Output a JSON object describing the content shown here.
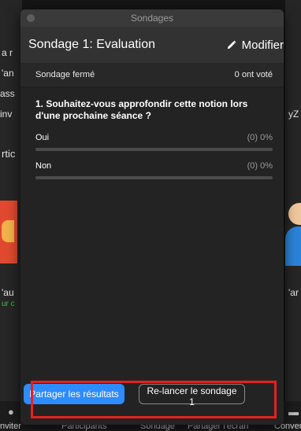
{
  "window": {
    "title": "Sondages"
  },
  "poll": {
    "title": "Sondage 1: Evaluation",
    "modify_label": "Modifier",
    "status": "Sondage fermé",
    "vote_count": "0 ont voté",
    "question": "1. Souhaitez-vous approfondir cette notion lors d'une prochaine séance ?",
    "answers": [
      {
        "label": "Oui",
        "result": "(0) 0%",
        "fraction": 0
      },
      {
        "label": "Non",
        "result": "(0) 0%",
        "fraction": 0
      }
    ],
    "share_button": "Partager les résultats",
    "relaunch_button": "Re-lancer le sondage 1"
  },
  "background": {
    "left_fragments": [
      "a r",
      "'an",
      "ass",
      "inv",
      "rtic",
      "'au",
      "ur c"
    ],
    "right_fragments": [
      "yZ",
      "'ar"
    ],
    "toolbar": [
      "nviter",
      "Participants",
      "Sondage",
      "Partager l'écran",
      "Conver"
    ]
  },
  "colors": {
    "accent": "#2d8cff",
    "highlight": "#e3241c",
    "panel": "#232323"
  }
}
